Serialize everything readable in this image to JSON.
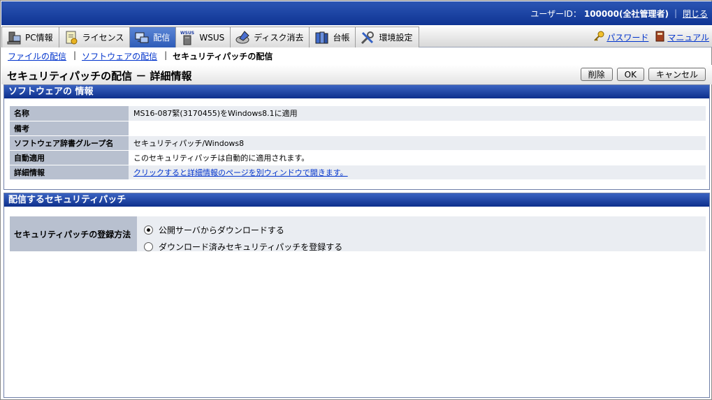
{
  "header": {
    "user_label": "ユーザーID：",
    "user_value": "100000(全社管理者)",
    "separator": "|",
    "close_label": "閉じる"
  },
  "nav": {
    "tabs": [
      {
        "label": "PC情報",
        "icon": "pc-icon",
        "active": false
      },
      {
        "label": "ライセンス",
        "icon": "license-icon",
        "active": false
      },
      {
        "label": "配信",
        "icon": "distribution-icon",
        "active": true
      },
      {
        "label": "WSUS",
        "icon": "wsus-icon",
        "active": false
      },
      {
        "label": "ディスク消去",
        "icon": "disk-erase-icon",
        "active": false
      },
      {
        "label": "台帳",
        "icon": "ledger-icon",
        "active": false
      },
      {
        "label": "環境設定",
        "icon": "settings-icon",
        "active": false
      }
    ],
    "password_label": "パスワード",
    "manual_label": "マニュアル"
  },
  "breadcrumb": {
    "file_dist": "ファイルの配信",
    "software_dist": "ソフトウェアの配信",
    "separator": "|",
    "current": "セキュリティパッチの配信"
  },
  "page": {
    "title": "セキュリティパッチの配信 － 詳細情報",
    "delete_label": "削除",
    "ok_label": "OK",
    "cancel_label": "キャンセル"
  },
  "software_info": {
    "heading": "ソフトウェアの 情報",
    "rows": [
      {
        "label": "名称",
        "value": "MS16-087緊(3170455)をWindows8.1に適用"
      },
      {
        "label": "備考",
        "value": ""
      },
      {
        "label": "ソフトウェア辞書グループ名",
        "value": "セキュリティパッチ/Windows8"
      },
      {
        "label": "自動適用",
        "value": "このセキュリティパッチは自動的に適用されます。"
      },
      {
        "label": "詳細情報",
        "value": "クリックすると詳細情報のページを別ウィンドウで開きます。"
      }
    ]
  },
  "patch_section": {
    "heading": "配信するセキュリティパッチ",
    "method_label": "セキュリティパッチの登録方法",
    "options": [
      {
        "label": "公開サーバからダウンロードする",
        "selected": true
      },
      {
        "label": "ダウンロード済みセキュリティパッチを登録する",
        "selected": false
      }
    ]
  },
  "colors": {
    "header_blue": "#0f3493",
    "link_blue": "#0033cc",
    "label_gray": "#b8c0cf"
  }
}
